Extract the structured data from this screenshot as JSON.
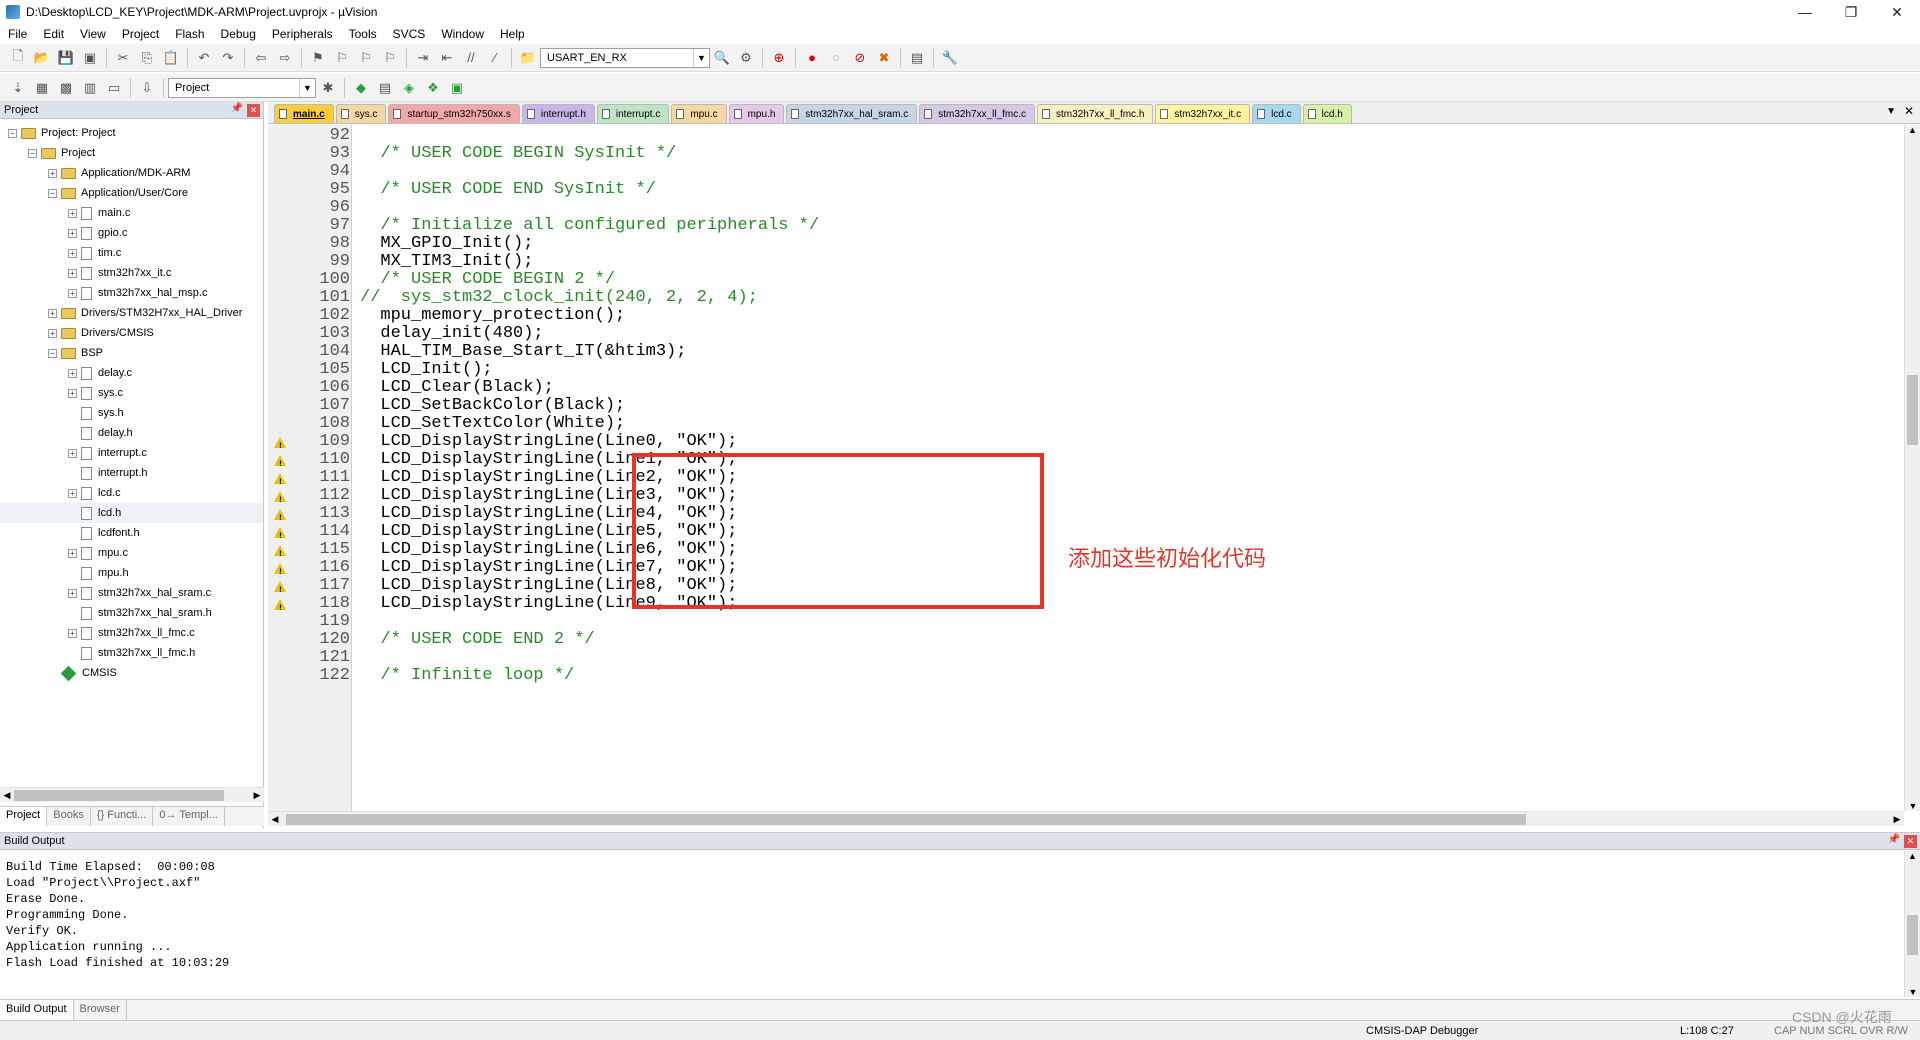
{
  "window": {
    "title": "D:\\Desktop\\LCD_KEY\\Project\\MDK-ARM\\Project.uvprojx - µVision",
    "minimize": "—",
    "maximize": "❐",
    "close": "✕"
  },
  "menu": [
    "File",
    "Edit",
    "View",
    "Project",
    "Flash",
    "Debug",
    "Peripherals",
    "Tools",
    "SVCS",
    "Window",
    "Help"
  ],
  "toolbar": {
    "find_combo": "USART_EN_RX",
    "target_combo": "Project"
  },
  "project_panel": {
    "title": "Project",
    "tree": [
      {
        "label": "Project: Project",
        "depth": 0,
        "kind": "root",
        "expander": "−"
      },
      {
        "label": "Project",
        "depth": 1,
        "kind": "folder",
        "expander": "−"
      },
      {
        "label": "Application/MDK-ARM",
        "depth": 2,
        "kind": "folder",
        "expander": "+"
      },
      {
        "label": "Application/User/Core",
        "depth": 2,
        "kind": "folder",
        "expander": "−"
      },
      {
        "label": "main.c",
        "depth": 3,
        "kind": "file",
        "expander": "+"
      },
      {
        "label": "gpio.c",
        "depth": 3,
        "kind": "file",
        "expander": "+"
      },
      {
        "label": "tim.c",
        "depth": 3,
        "kind": "file",
        "expander": "+"
      },
      {
        "label": "stm32h7xx_it.c",
        "depth": 3,
        "kind": "file",
        "expander": "+"
      },
      {
        "label": "stm32h7xx_hal_msp.c",
        "depth": 3,
        "kind": "file",
        "expander": "+"
      },
      {
        "label": "Drivers/STM32H7xx_HAL_Driver",
        "depth": 2,
        "kind": "folder",
        "expander": "+"
      },
      {
        "label": "Drivers/CMSIS",
        "depth": 2,
        "kind": "folder",
        "expander": "+"
      },
      {
        "label": "BSP",
        "depth": 2,
        "kind": "folder",
        "expander": "−"
      },
      {
        "label": "delay.c",
        "depth": 3,
        "kind": "file",
        "expander": "+"
      },
      {
        "label": "sys.c",
        "depth": 3,
        "kind": "file",
        "expander": "+"
      },
      {
        "label": "sys.h",
        "depth": 3,
        "kind": "file",
        "expander": ""
      },
      {
        "label": "delay.h",
        "depth": 3,
        "kind": "file",
        "expander": ""
      },
      {
        "label": "interrupt.c",
        "depth": 3,
        "kind": "file",
        "expander": "+"
      },
      {
        "label": "interrupt.h",
        "depth": 3,
        "kind": "file",
        "expander": ""
      },
      {
        "label": "lcd.c",
        "depth": 3,
        "kind": "file",
        "expander": "+"
      },
      {
        "label": "lcd.h",
        "depth": 3,
        "kind": "file",
        "expander": "",
        "selected": true
      },
      {
        "label": "lcdfont.h",
        "depth": 3,
        "kind": "file",
        "expander": ""
      },
      {
        "label": "mpu.c",
        "depth": 3,
        "kind": "file",
        "expander": "+"
      },
      {
        "label": "mpu.h",
        "depth": 3,
        "kind": "file",
        "expander": ""
      },
      {
        "label": "stm32h7xx_hal_sram.c",
        "depth": 3,
        "kind": "file",
        "expander": "+"
      },
      {
        "label": "stm32h7xx_hal_sram.h",
        "depth": 3,
        "kind": "file",
        "expander": ""
      },
      {
        "label": "stm32h7xx_ll_fmc.c",
        "depth": 3,
        "kind": "file",
        "expander": "+"
      },
      {
        "label": "stm32h7xx_ll_fmc.h",
        "depth": 3,
        "kind": "file",
        "expander": ""
      },
      {
        "label": "CMSIS",
        "depth": 2,
        "kind": "component",
        "expander": ""
      }
    ],
    "tabs": [
      "Project",
      "Books",
      "{} Functi...",
      "0→ Templ..."
    ]
  },
  "editor": {
    "tabs": [
      {
        "label": "main.c",
        "color": "#ffcd3c",
        "active": true
      },
      {
        "label": "sys.c",
        "color": "#f5d7a3"
      },
      {
        "label": "startup_stm32h750xx.s",
        "color": "#f2a8a8"
      },
      {
        "label": "interrupt.h",
        "color": "#c9b6e8"
      },
      {
        "label": "interrupt.c",
        "color": "#bfe3c5"
      },
      {
        "label": "mpu.c",
        "color": "#f5d7a3"
      },
      {
        "label": "mpu.h",
        "color": "#e8c8e8"
      },
      {
        "label": "stm32h7xx_hal_sram.c",
        "color": "#c9d4e8"
      },
      {
        "label": "stm32h7xx_ll_fmc.c",
        "color": "#d4c8e8"
      },
      {
        "label": "stm32h7xx_ll_fmc.h",
        "color": "#f8f0c0"
      },
      {
        "label": "stm32h7xx_it.c",
        "color": "#fff3a0"
      },
      {
        "label": "lcd.c",
        "color": "#a8d8f0"
      },
      {
        "label": "lcd.h",
        "color": "#d8f0a8"
      }
    ],
    "lines": [
      {
        "n": "92",
        "text": "",
        "cls": ""
      },
      {
        "n": "93",
        "text": "  /* USER CODE BEGIN SysInit */",
        "cls": "c-comment"
      },
      {
        "n": "94",
        "text": "",
        "cls": ""
      },
      {
        "n": "95",
        "text": "  /* USER CODE END SysInit */",
        "cls": "c-comment"
      },
      {
        "n": "96",
        "text": "",
        "cls": ""
      },
      {
        "n": "97",
        "text": "  /* Initialize all configured peripherals */",
        "cls": "c-comment"
      },
      {
        "n": "98",
        "text": "  MX_GPIO_Init();",
        "cls": ""
      },
      {
        "n": "99",
        "text": "  MX_TIM3_Init();",
        "cls": ""
      },
      {
        "n": "100",
        "text": "  /* USER CODE BEGIN 2 */",
        "cls": "c-comment"
      },
      {
        "n": "101",
        "text": "//  sys_stm32_clock_init(240, 2, 2, 4);",
        "cls": "c-comment"
      },
      {
        "n": "102",
        "text": "  mpu_memory_protection();",
        "cls": ""
      },
      {
        "n": "103",
        "text": "  delay_init(480);",
        "cls": ""
      },
      {
        "n": "104",
        "text": "  HAL_TIM_Base_Start_IT(&htim3);",
        "cls": ""
      },
      {
        "n": "105",
        "text": "  LCD_Init();",
        "cls": ""
      },
      {
        "n": "106",
        "text": "  LCD_Clear(Black);",
        "cls": ""
      },
      {
        "n": "107",
        "text": "  LCD_SetBackColor(Black);",
        "cls": ""
      },
      {
        "n": "108",
        "text": "  LCD_SetTextColor(White);",
        "cls": ""
      },
      {
        "n": "109",
        "text": "  LCD_DisplayStringLine(Line0, \"OK\");",
        "cls": "",
        "warn": true
      },
      {
        "n": "110",
        "text": "  LCD_DisplayStringLine(Line1, \"OK\");",
        "cls": "",
        "warn": true
      },
      {
        "n": "111",
        "text": "  LCD_DisplayStringLine(Line2, \"OK\");",
        "cls": "",
        "warn": true
      },
      {
        "n": "112",
        "text": "  LCD_DisplayStringLine(Line3, \"OK\");",
        "cls": "",
        "warn": true
      },
      {
        "n": "113",
        "text": "  LCD_DisplayStringLine(Line4, \"OK\");",
        "cls": "",
        "warn": true
      },
      {
        "n": "114",
        "text": "  LCD_DisplayStringLine(Line5, \"OK\");",
        "cls": "",
        "warn": true
      },
      {
        "n": "115",
        "text": "  LCD_DisplayStringLine(Line6, \"OK\");",
        "cls": "",
        "warn": true
      },
      {
        "n": "116",
        "text": "  LCD_DisplayStringLine(Line7, \"OK\");",
        "cls": "",
        "warn": true
      },
      {
        "n": "117",
        "text": "  LCD_DisplayStringLine(Line8, \"OK\");",
        "cls": "",
        "warn": true
      },
      {
        "n": "118",
        "text": "  LCD_DisplayStringLine(Line9, \"OK\");",
        "cls": "",
        "warn": true
      },
      {
        "n": "119",
        "text": "",
        "cls": ""
      },
      {
        "n": "120",
        "text": "  /* USER CODE END 2 */",
        "cls": "c-comment"
      },
      {
        "n": "121",
        "text": "",
        "cls": ""
      },
      {
        "n": "122",
        "text": "  /* Infinite loop */",
        "cls": "c-comment"
      }
    ],
    "annotation": "添加这些初始化代码",
    "highlight_color": "#e8332a"
  },
  "build_output": {
    "title": "Build Output",
    "text": "Build Time Elapsed:  00:00:08\nLoad \"Project\\\\Project.axf\"\nErase Done.\nProgramming Done.\nVerify OK.\nApplication running ...\nFlash Load finished at 10:03:29",
    "tabs": [
      "Build Output",
      "Browser"
    ]
  },
  "status": {
    "debugger": "CMSIS-DAP Debugger",
    "cursor": "L:108 C:27",
    "flags": "CAP NUM SCRL OVR R/W",
    "watermark": "CSDN @火花雨"
  }
}
